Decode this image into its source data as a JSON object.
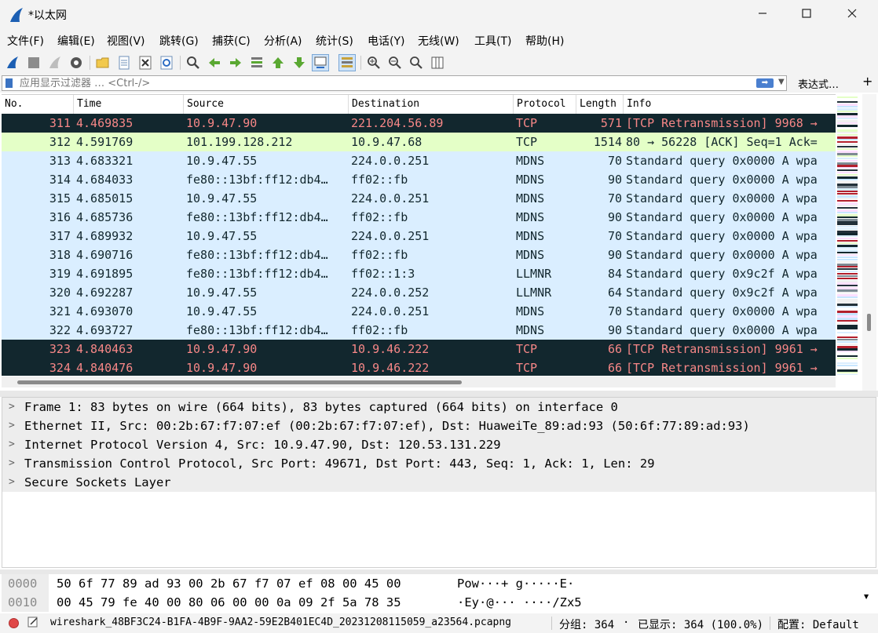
{
  "window": {
    "title": "*以太网"
  },
  "menu": [
    "文件(F)",
    "编辑(E)",
    "视图(V)",
    "跳转(G)",
    "捕获(C)",
    "分析(A)",
    "统计(S)",
    "电话(Y)",
    "无线(W)",
    "工具(T)",
    "帮助(H)"
  ],
  "toolbar": {
    "icons": [
      "shark-fin-start-icon",
      "stop-square-icon",
      "restart-fin-icon",
      "capture-options-gear-icon",
      "open-folder-icon",
      "save-file-icon",
      "close-file-icon",
      "reload-icon",
      "find-magnifier-icon",
      "go-back-arrow-icon",
      "go-forward-arrow-icon",
      "go-to-packet-icon",
      "first-packet-icon",
      "last-packet-icon",
      "autoscroll-icon",
      "colorize-icon",
      "zoom-in-icon",
      "zoom-out-icon",
      "zoom-normal-icon",
      "resize-columns-icon"
    ]
  },
  "filter": {
    "placeholder": "应用显示过滤器 … <Ctrl-/>",
    "expression_label": "表达式…",
    "add_label": "+"
  },
  "columns": [
    "No.",
    "Time",
    "Source",
    "Destination",
    "Protocol",
    "Length",
    "Info"
  ],
  "packets": [
    {
      "no": "311",
      "time": "4.469835",
      "src": "10.9.47.90",
      "dst": "221.204.56.89",
      "proto": "TCP",
      "len": "571",
      "info": "[TCP Retransmission] 9968 →",
      "style": "dark"
    },
    {
      "no": "312",
      "time": "4.591769",
      "src": "101.199.128.212",
      "dst": "10.9.47.68",
      "proto": "TCP",
      "len": "1514",
      "info": "80 → 56228 [ACK] Seq=1 Ack=",
      "style": "green"
    },
    {
      "no": "313",
      "time": "4.683321",
      "src": "10.9.47.55",
      "dst": "224.0.0.251",
      "proto": "MDNS",
      "len": "70",
      "info": "Standard query 0x0000 A wpa",
      "style": "blue"
    },
    {
      "no": "314",
      "time": "4.684033",
      "src": "fe80::13bf:ff12:db4…",
      "dst": "ff02::fb",
      "proto": "MDNS",
      "len": "90",
      "info": "Standard query 0x0000 A wpa",
      "style": "blue"
    },
    {
      "no": "315",
      "time": "4.685015",
      "src": "10.9.47.55",
      "dst": "224.0.0.251",
      "proto": "MDNS",
      "len": "70",
      "info": "Standard query 0x0000 A wpa",
      "style": "blue"
    },
    {
      "no": "316",
      "time": "4.685736",
      "src": "fe80::13bf:ff12:db4…",
      "dst": "ff02::fb",
      "proto": "MDNS",
      "len": "90",
      "info": "Standard query 0x0000 A wpa",
      "style": "blue"
    },
    {
      "no": "317",
      "time": "4.689932",
      "src": "10.9.47.55",
      "dst": "224.0.0.251",
      "proto": "MDNS",
      "len": "70",
      "info": "Standard query 0x0000 A wpa",
      "style": "blue"
    },
    {
      "no": "318",
      "time": "4.690716",
      "src": "fe80::13bf:ff12:db4…",
      "dst": "ff02::fb",
      "proto": "MDNS",
      "len": "90",
      "info": "Standard query 0x0000 A wpa",
      "style": "blue"
    },
    {
      "no": "319",
      "time": "4.691895",
      "src": "fe80::13bf:ff12:db4…",
      "dst": "ff02::1:3",
      "proto": "LLMNR",
      "len": "84",
      "info": "Standard query 0x9c2f A wpa",
      "style": "blue"
    },
    {
      "no": "320",
      "time": "4.692287",
      "src": "10.9.47.55",
      "dst": "224.0.0.252",
      "proto": "LLMNR",
      "len": "64",
      "info": "Standard query 0x9c2f A wpa",
      "style": "blue"
    },
    {
      "no": "321",
      "time": "4.693070",
      "src": "10.9.47.55",
      "dst": "224.0.0.251",
      "proto": "MDNS",
      "len": "70",
      "info": "Standard query 0x0000 A wpa",
      "style": "blue"
    },
    {
      "no": "322",
      "time": "4.693727",
      "src": "fe80::13bf:ff12:db4…",
      "dst": "ff02::fb",
      "proto": "MDNS",
      "len": "90",
      "info": "Standard query 0x0000 A wpa",
      "style": "blue"
    },
    {
      "no": "323",
      "time": "4.840463",
      "src": "10.9.47.90",
      "dst": "10.9.46.222",
      "proto": "TCP",
      "len": "66",
      "info": "[TCP Retransmission] 9961 →",
      "style": "dark"
    },
    {
      "no": "324",
      "time": "4.840476",
      "src": "10.9.47.90",
      "dst": "10.9.46.222",
      "proto": "TCP",
      "len": "66",
      "info": "[TCP Retransmission] 9961 →",
      "style": "dark"
    }
  ],
  "details": [
    "Frame 1: 83 bytes on wire (664 bits), 83 bytes captured (664 bits) on interface 0",
    "Ethernet II, Src: 00:2b:67:f7:07:ef (00:2b:67:f7:07:ef), Dst: HuaweiTe_89:ad:93 (50:6f:77:89:ad:93)",
    "Internet Protocol Version 4, Src: 10.9.47.90, Dst: 120.53.131.229",
    "Transmission Control Protocol, Src Port: 49671, Dst Port: 443, Seq: 1, Ack: 1, Len: 29",
    "Secure Sockets Layer"
  ],
  "bytes": [
    {
      "offset": "0000",
      "hex": "50 6f 77 89 ad 93 00 2b  67 f7 07 ef 08 00 45 00",
      "ascii": "Pow···+ g·····E·"
    },
    {
      "offset": "0010",
      "hex": "00 45 79 fe 40 00 80 06  00 00 0a 09 2f 5a 78 35",
      "ascii": "·Ey·@··· ····/Zx5"
    }
  ],
  "status": {
    "file": "wireshark_48BF3C24-B1FA-4B9F-9AA2-59E2B401EC4D_20231208115059_a23564.pcapng",
    "packets": "分组: 364",
    "displayed": "已显示: 364 (100.0%)",
    "profile": "配置: Default"
  },
  "colors": {
    "dark_bg": "#12272e",
    "dark_fg": "#f78787",
    "green_bg": "#e4ffc7",
    "blue_bg": "#daeeff",
    "text": "#12272e"
  }
}
